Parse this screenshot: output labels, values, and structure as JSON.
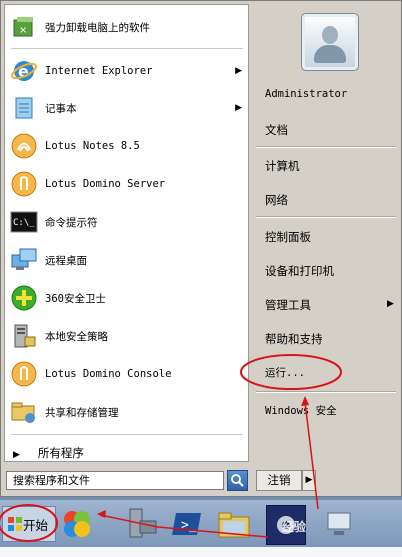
{
  "left_items": [
    {
      "label": "强力卸载电脑上的软件",
      "icon": "uninstall-icon",
      "submenu": false
    },
    {
      "label": "Internet Explorer",
      "icon": "internet-explorer-icon",
      "submenu": true
    },
    {
      "label": "记事本",
      "icon": "notepad-icon",
      "submenu": true
    },
    {
      "label": "Lotus Notes 8.5",
      "icon": "lotus-notes-icon",
      "submenu": false
    },
    {
      "label": "Lotus Domino Server",
      "icon": "lotus-domino-icon",
      "submenu": false
    },
    {
      "label": "命令提示符",
      "icon": "command-prompt-icon",
      "submenu": false
    },
    {
      "label": "远程桌面",
      "icon": "remote-desktop-icon",
      "submenu": false
    },
    {
      "label": "360安全卫士",
      "icon": "360-security-icon",
      "submenu": false
    },
    {
      "label": "本地安全策略",
      "icon": "local-security-policy-icon",
      "submenu": false
    },
    {
      "label": "Lotus Domino  Console",
      "icon": "lotus-domino-console-icon",
      "submenu": false
    },
    {
      "label": "共享和存储管理",
      "icon": "share-storage-icon",
      "submenu": false
    }
  ],
  "all_programs": "所有程序",
  "search_placeholder": "搜索程序和文件",
  "right_items": [
    {
      "label": "Administrator"
    },
    {
      "label": "文档"
    },
    {
      "label": "计算机"
    },
    {
      "label": "网络"
    },
    {
      "label": "控制面板"
    },
    {
      "label": "设备和打印机"
    },
    {
      "label": "管理工具"
    },
    {
      "label": "帮助和支持"
    },
    {
      "label": "运行..."
    },
    {
      "label": "Windows 安全"
    }
  ],
  "logoff_label": "注销",
  "start_label": "开始",
  "watermark": "经验",
  "colors": {
    "annotation": "#d8141a",
    "selection": "#3168c5"
  }
}
